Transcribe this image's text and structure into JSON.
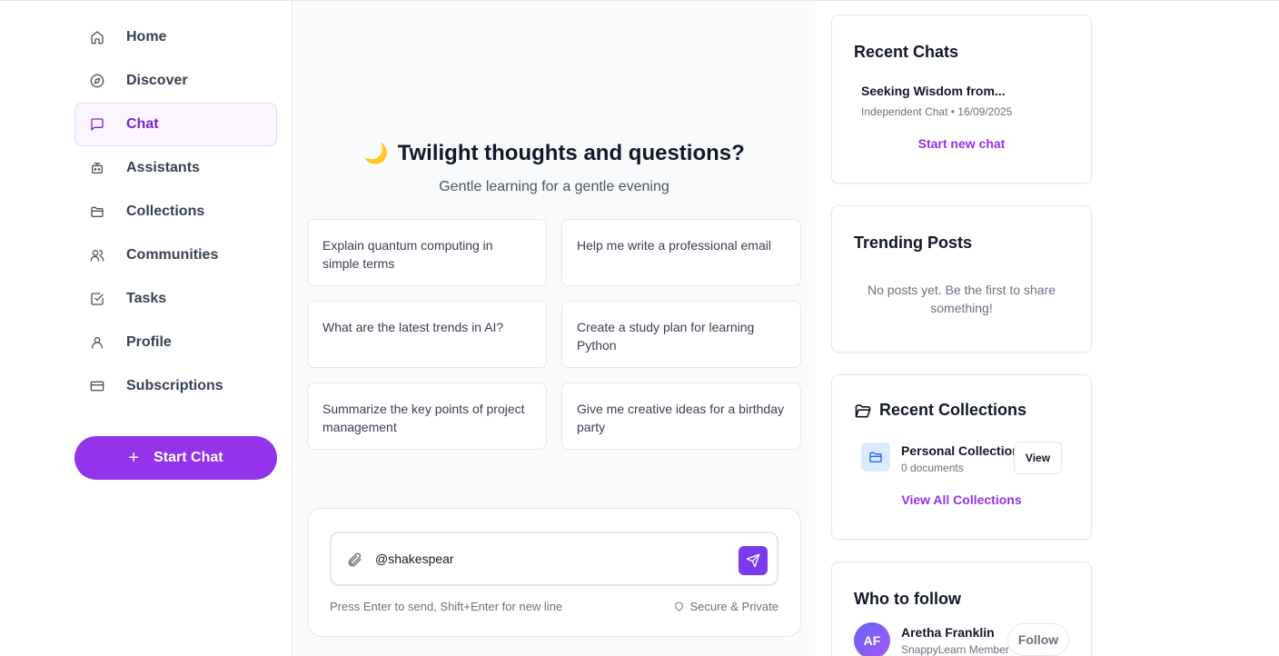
{
  "sidebar": {
    "items": [
      {
        "label": "Home",
        "icon": "home-icon"
      },
      {
        "label": "Discover",
        "icon": "compass-icon"
      },
      {
        "label": "Chat",
        "icon": "chat-icon",
        "active": true
      },
      {
        "label": "Assistants",
        "icon": "robot-icon"
      },
      {
        "label": "Collections",
        "icon": "folder-icon"
      },
      {
        "label": "Communities",
        "icon": "users-icon"
      },
      {
        "label": "Tasks",
        "icon": "checkbox-icon"
      },
      {
        "label": "Profile",
        "icon": "user-icon"
      },
      {
        "label": "Subscriptions",
        "icon": "credit-card-icon"
      }
    ],
    "start_chat_label": "Start Chat"
  },
  "main": {
    "title": "Twilight thoughts and questions?",
    "title_emoji": "🌙",
    "subtitle": "Gentle learning for a gentle evening",
    "suggestions": [
      "Explain quantum computing in simple terms",
      "Help me write a professional email",
      "What are the latest trends in AI?",
      "Create a study plan for learning Python",
      "Summarize the key points of project management",
      "Give me creative ideas for a birthday party"
    ],
    "composer": {
      "value": "@shakespear",
      "hint": "Press Enter to send, Shift+Enter for new line",
      "secure": "Secure & Private"
    }
  },
  "rail": {
    "recent_chats": {
      "title": "Recent Chats",
      "item_title": "Seeking Wisdom from...",
      "item_meta": "Independent Chat • 16/09/2025",
      "link": "Start new chat"
    },
    "trending": {
      "title": "Trending Posts",
      "empty": "No posts yet. Be the first to share something!"
    },
    "collections": {
      "title": "Recent Collections",
      "item_name": "Personal Collection",
      "item_count": "0 documents",
      "view_label": "View",
      "view_all": "View All Collections"
    },
    "follow": {
      "title": "Who to follow",
      "avatar": "AF",
      "name": "Aretha Franklin",
      "sub": "SnappyLearn Member",
      "button": "Follow"
    }
  },
  "colors": {
    "accent": "#9333ea",
    "send": "#7c3aed",
    "active_bg": "#faf5ff"
  }
}
